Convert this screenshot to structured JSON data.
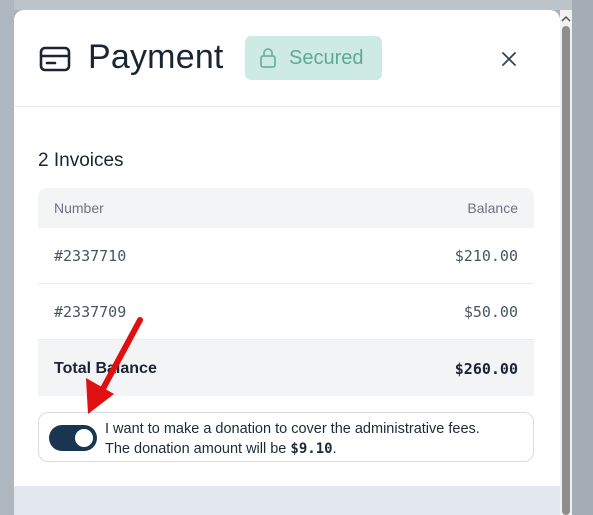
{
  "modal": {
    "title": "Payment",
    "badge": "Secured",
    "close_label": "×"
  },
  "invoices": {
    "heading": "2 Invoices",
    "columns": {
      "number": "Number",
      "balance": "Balance"
    },
    "rows": [
      {
        "number": "#2337710",
        "balance": "$210.00"
      },
      {
        "number": "#2337709",
        "balance": "$50.00"
      }
    ],
    "total": {
      "label": "Total Balance",
      "value": "$260.00"
    }
  },
  "donation": {
    "toggle_on": true,
    "text_line1": "I want to make a donation to cover the administrative fees.",
    "text_line2_prefix": "The donation amount will be ",
    "amount": "$9.10",
    "text_line2_suffix": "."
  },
  "colors": {
    "badge_bg": "#cdeae3",
    "badge_text": "#5ea897",
    "toggle_bg": "#1a3550",
    "annotation_arrow": "#e01010"
  },
  "icons": [
    "credit-card-icon",
    "lock-icon",
    "close-icon",
    "scroll-up-icon"
  ]
}
